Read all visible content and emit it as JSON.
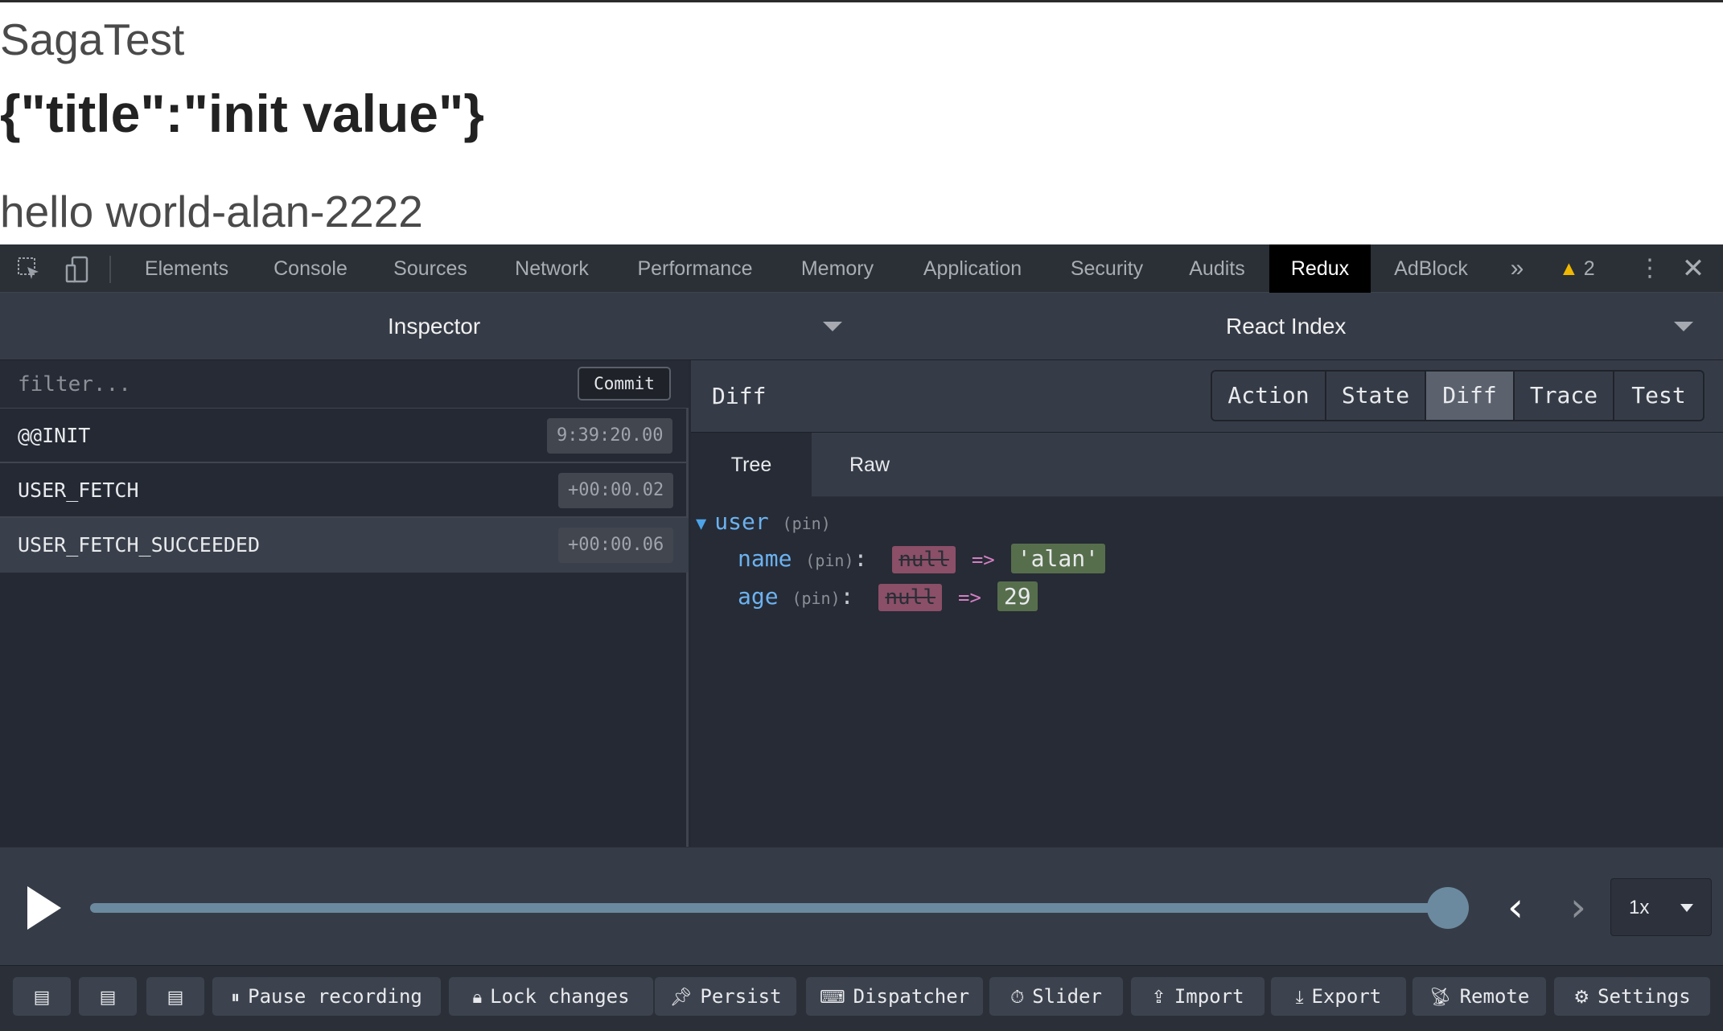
{
  "page": {
    "title": "SagaTest",
    "json_text": "{\"title\":\"init value\"}",
    "hello": "hello world-alan-2222"
  },
  "devtools": {
    "tabs": [
      "Elements",
      "Console",
      "Sources",
      "Network",
      "Performance",
      "Memory",
      "Application",
      "Security",
      "Audits",
      "Redux",
      "AdBlock"
    ],
    "active_tab": "Redux",
    "overflow": "»",
    "warnings_count": "2",
    "kebab": "⋮",
    "close": "✕"
  },
  "monitors": {
    "left_label": "Inspector",
    "right_label": "React Index"
  },
  "inspector": {
    "filter_placeholder": "filter...",
    "commit_label": "Commit",
    "actions": [
      {
        "name": "@@INIT",
        "time": "9:39:20.00",
        "selected": false
      },
      {
        "name": "USER_FETCH",
        "time": "+00:00.02",
        "selected": false
      },
      {
        "name": "USER_FETCH_SUCCEEDED",
        "time": "+00:00.06",
        "selected": true
      }
    ]
  },
  "detail": {
    "title": "Diff",
    "tabs": [
      "Action",
      "State",
      "Diff",
      "Trace",
      "Test"
    ],
    "active_tab": "Diff",
    "subtabs": [
      "Tree",
      "Raw"
    ],
    "active_subtab": "Tree",
    "tree": {
      "root_key": "user",
      "pin": "(pin)",
      "colon": ":",
      "arrow": "=>",
      "rows": [
        {
          "key": "name",
          "old": "null",
          "new": "'alan'"
        },
        {
          "key": "age",
          "old": "null",
          "new": "29"
        }
      ]
    }
  },
  "slider": {
    "position": 1.0,
    "speed": "1x"
  },
  "toolbar": {
    "buttons": [
      {
        "label": "",
        "icon": "layout-left-icon"
      },
      {
        "label": "",
        "icon": "layout-right-icon"
      },
      {
        "label": "",
        "icon": "layout-bottom-icon"
      },
      {
        "label": "Pause recording",
        "icon": "pause-icon"
      },
      {
        "label": "Lock changes",
        "icon": "lock-icon"
      },
      {
        "label": "Persist",
        "icon": "pin-icon"
      },
      {
        "label": "Dispatcher",
        "icon": "keyboard-icon"
      },
      {
        "label": "Slider",
        "icon": "timer-icon"
      },
      {
        "label": "Import",
        "icon": "upload-icon"
      },
      {
        "label": "Export",
        "icon": "download-icon"
      },
      {
        "label": "Remote",
        "icon": "broadcast-icon"
      },
      {
        "label": "Settings",
        "icon": "gear-icon"
      }
    ]
  },
  "colors": {
    "accent": "#6b8aa0",
    "diff_removed": "#8b4f68",
    "diff_added": "#576e4c",
    "key": "#6cb2f0"
  }
}
